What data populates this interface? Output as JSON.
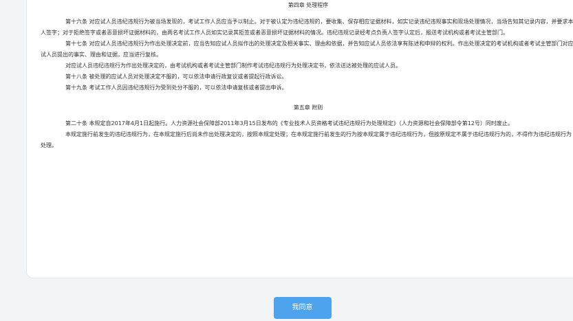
{
  "document": {
    "chapter4_title": "第四章  处理程序",
    "chapter4_paragraphs": [
      "第十六条  对应试人员违纪违规行为被当场发现的，考试工作人员应当予以制止。对于被认定为违纪违规的，要收集、保存相应证据材料，如实记录违纪违规事实和现场处理情况，当场告知其记录内容，并要求本人签字；对于拒绝签字或者恶意损坏证据材料的，由两名考试工作人员如实记录其拒签或者恶意损坏证据材料的情况。违纪违规记录经考点负责人签字认定后，报送考试机构或者考试主管部门。",
      "第十七条  对应试人员违纪违规行为作出处理决定前，应当告知应试人员拟作出的处理决定及相关事实、理由和依据，并告知应试人员依法享有陈述和申辩的权利。作出处理决定的考试机构或者考试主管部门对应试人员提出的事实、理由和证据，应当进行复核。",
      "对应试人员违纪违规行为作出处理决定的，由考试机构或者考试主管部门制作考试违纪违规行为处理决定书，依法送达被处理的应试人员。",
      "第十八条  被处理的应试人员对处理决定不服的，可以依法申请行政复议或者提起行政诉讼。",
      "第十九条  考试工作人员因违纪违规行为受到处分不服的，可以依法申请复核或者提出申诉。"
    ],
    "chapter5_title": "第五章  附则",
    "chapter5_paragraphs": [
      "第二十条  本规定自2017年4月1日起施行。人力资源社会保障部2011年3月15日发布的《专业技术人员资格考试违纪违规行为处理规定》（人力资源和社会保障部令第12号）同时废止。",
      "本规定施行前发生的违纪违规行为，在本规定施行后尚未作出处理决定的，按照本规定处理；在本规定施行前发生的行为按本规定属于违纪违规行为，但按原规定不属于违纪违规行为的，不得作为违纪违规行为处理。"
    ]
  },
  "actions": {
    "agree_label": "我同意"
  },
  "colors": {
    "button": "#4da3ee",
    "page_background": "#f3f4f6"
  }
}
